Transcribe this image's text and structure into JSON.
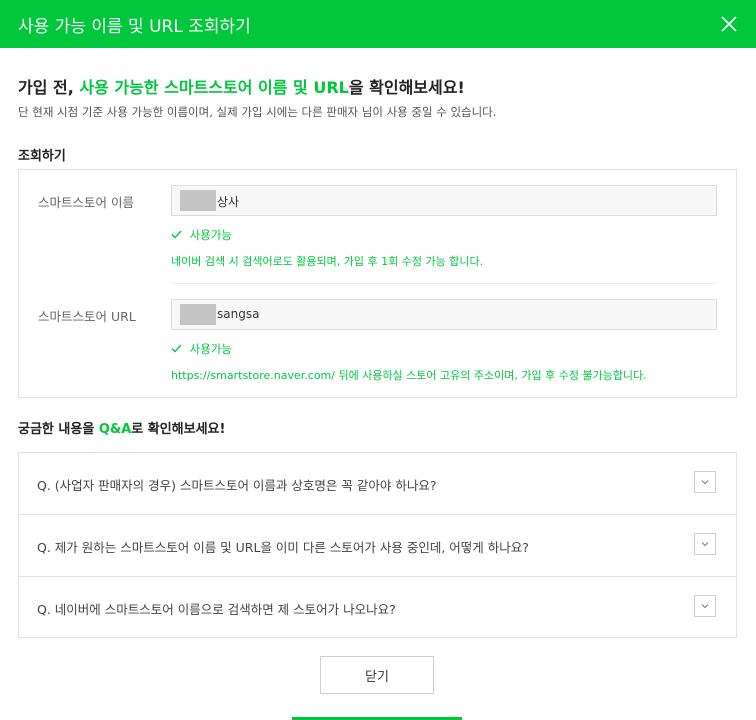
{
  "modal": {
    "title": "사용 가능 이름 및 URL 조회하기"
  },
  "intro": {
    "headline_prefix": "가입 전, ",
    "headline_highlight": "사용 가능한 스마트스토어 이름 및 URL",
    "headline_suffix": "을 확인해보세요!",
    "subtext": "단 현재 시점 기준 사용 가능한 이름이며, 실제 가입 시에는 다른 판매자 님이 사용 중일 수 있습니다."
  },
  "lookup": {
    "section_label": "조회하기",
    "name": {
      "label": "스마트스토어 이름",
      "value": "상사",
      "status": "사용가능",
      "help": "네이버 검색 시 검색어로도 활용되며, 가입 후 1회 수정 가능 합니다."
    },
    "url": {
      "label": "스마트스토어 URL",
      "value": "sangsa",
      "status": "사용가능",
      "help": "https://smartstore.naver.com/ 뒤에 사용하실 스토어 고유의 주소이며, 가입 후 수정 불가능합니다."
    }
  },
  "faq": {
    "label_prefix": "궁금한 내용을 ",
    "label_highlight": "Q&A",
    "label_suffix": "로 확인해보세요!",
    "items": [
      {
        "question": "Q. (사업자 판매자의 경우) 스마트스토어 이름과 상호명은 꼭 같아야 하나요?"
      },
      {
        "question": "Q. 제가 원하는 스마트스토어 이름 및 URL을 이미 다른 스토어가 사용 중인데, 어떻게 하나요?"
      },
      {
        "question": "Q. 네이버에 스마트스토어 이름으로 검색하면 제 스토어가 나오나요?"
      }
    ]
  },
  "footer": {
    "close_label": "닫기"
  },
  "colors": {
    "accent": "#00c73c"
  },
  "icons": {
    "close": "close-icon",
    "check": "check-icon",
    "toggle": "chevron-down-icon"
  }
}
